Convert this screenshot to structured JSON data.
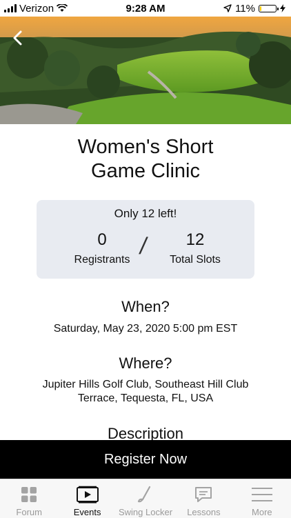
{
  "status_bar": {
    "carrier": "Verizon",
    "time": "9:28 AM",
    "battery_text": "11%",
    "battery_level": 0.11
  },
  "event": {
    "title": "Women's Short Game Clinic",
    "slots_note": "Only 12 left!",
    "registrants_count": "0",
    "registrants_label": "Registrants",
    "separator": "/",
    "total_slots_count": "12",
    "total_slots_label": "Total Slots",
    "when_heading": "When?",
    "when_value": "Saturday, May 23, 2020 5:00 pm EST",
    "where_heading": "Where?",
    "where_value": "Jupiter Hills Golf Club, Southeast Hill Club Terrace, Tequesta, FL, USA",
    "description_heading": "Description"
  },
  "register_button": {
    "label": "Register Now"
  },
  "tab_bar": {
    "active_tab": "Events",
    "tabs": [
      {
        "label": "Forum",
        "icon": "grid-icon"
      },
      {
        "label": "Events",
        "icon": "calendar-icon"
      },
      {
        "label": "Swing Locker",
        "icon": "golf-club-icon"
      },
      {
        "label": "Lessons",
        "icon": "chat-bubble-icon"
      },
      {
        "label": "More",
        "icon": "menu-icon"
      }
    ]
  },
  "colors": {
    "card_background": "#e8ebf1",
    "register_background": "#000000",
    "tab_inactive": "#9a9a9a",
    "battery_fill": "#f5c800"
  }
}
